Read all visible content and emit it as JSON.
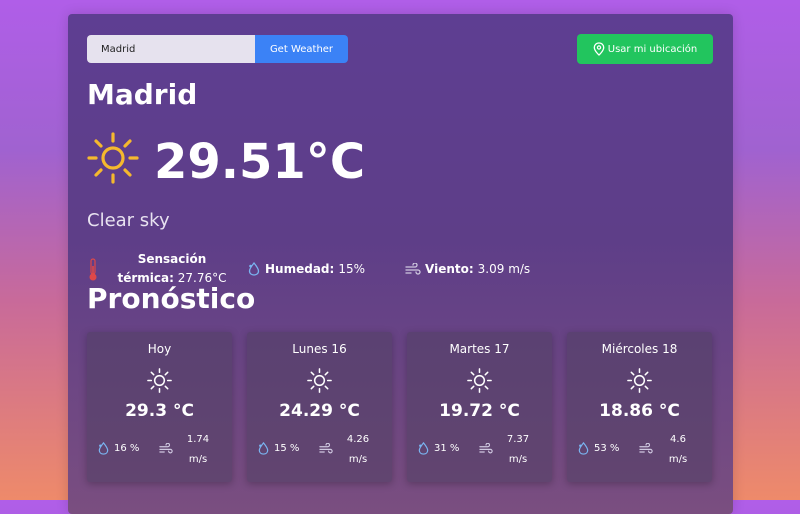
{
  "search": {
    "value": "Madrid",
    "button_label": "Get Weather"
  },
  "location_button": {
    "label": "Usar mi ubicación",
    "icon": "map-pin-icon"
  },
  "current": {
    "city": "Madrid",
    "temperature": "29.51°C",
    "description": "Clear sky",
    "icon": "sun-icon",
    "feels_like_label": "Sensación térmica:",
    "feels_like_value": "27.76°C",
    "humidity_label": "Humedad:",
    "humidity_value": "15%",
    "wind_label": "Viento:",
    "wind_value": "3.09 m/s"
  },
  "forecast": {
    "title": "Pronóstico",
    "days": [
      {
        "day": "Hoy",
        "temp": "29.3 °C",
        "humidity": "16 %",
        "wind_value": "1.74",
        "wind_unit": "m/s"
      },
      {
        "day": "Lunes 16",
        "temp": "24.29 °C",
        "humidity": "15 %",
        "wind_value": "4.26",
        "wind_unit": "m/s"
      },
      {
        "day": "Martes 17",
        "temp": "19.72 °C",
        "humidity": "31 %",
        "wind_value": "7.37",
        "wind_unit": "m/s"
      },
      {
        "day": "Miércoles 18",
        "temp": "18.86 °C",
        "humidity": "53 %",
        "wind_value": "4.6",
        "wind_unit": "m/s"
      }
    ]
  },
  "colors": {
    "get_button": "#3b82f6",
    "location_button": "#22c55e",
    "sun": "#f5b82e",
    "humidity_icon": "#7ab4f0",
    "thermometer": "#e04848"
  }
}
